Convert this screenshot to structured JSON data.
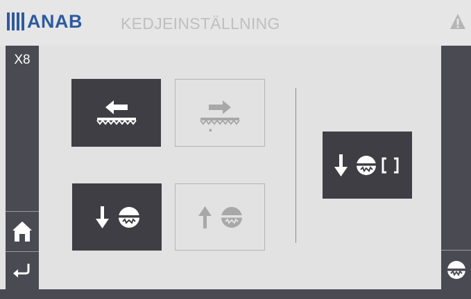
{
  "header": {
    "logo_text": "ANAB",
    "title": "KEDJEINSTÄLLNING",
    "warning_icon": "warning-triangle-icon"
  },
  "left_bar": {
    "machine_label": "X8",
    "home_icon": "home-icon",
    "back_icon": "return-arrow-icon"
  },
  "right_bar": {
    "saw_icon": "saw-blade-icon"
  },
  "main": {
    "buttons": [
      {
        "name": "move-chain-left-button",
        "icon": "arrow-left-chain-icon",
        "state": "active"
      },
      {
        "name": "move-chain-right-button",
        "icon": "arrow-right-chain-icon",
        "state": "disabled",
        "marker": "×"
      },
      {
        "name": "lower-blade-button",
        "icon": "arrow-down-blade-icon",
        "state": "active"
      },
      {
        "name": "raise-blade-button",
        "icon": "arrow-up-blade-icon",
        "state": "disabled"
      },
      {
        "name": "lower-blade-clamp-button",
        "icon": "arrow-down-blade-bracket-icon",
        "state": "active"
      }
    ]
  },
  "colors": {
    "brand_blue": "#2d5aa0",
    "dark_panel": "#4a4a52",
    "dark_button": "#3e3e44",
    "background": "#e2e2e2",
    "disabled_icon": "#a8a8a8"
  }
}
